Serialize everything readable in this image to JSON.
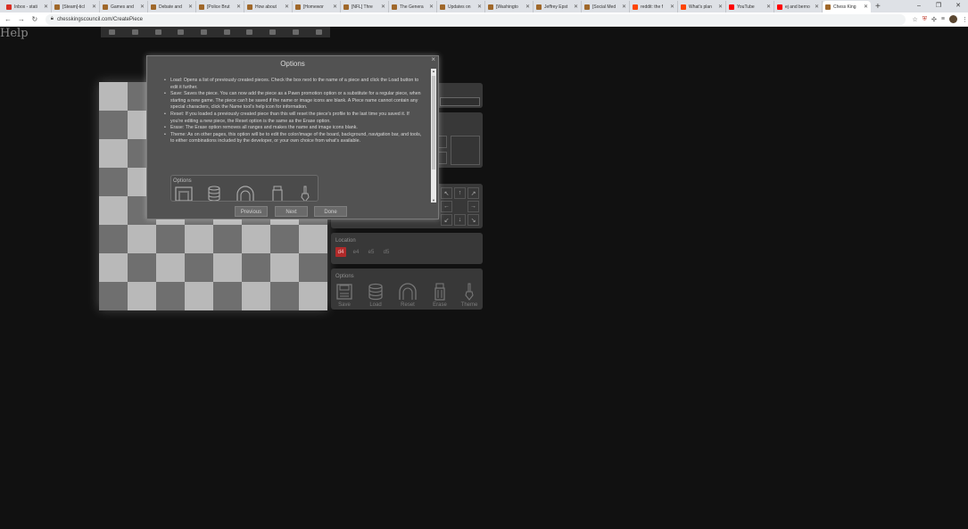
{
  "browser": {
    "tabs": [
      {
        "title": "Inbox - stati",
        "color": "#d93025"
      },
      {
        "title": "[Steam]-ticl",
        "color": "#a0682a"
      },
      {
        "title": "Games and",
        "color": "#a0682a"
      },
      {
        "title": "Debate and",
        "color": "#a0682a"
      },
      {
        "title": "[Police Brut",
        "color": "#a0682a"
      },
      {
        "title": "How about",
        "color": "#a0682a"
      },
      {
        "title": "[Homewor",
        "color": "#a0682a"
      },
      {
        "title": "[NFL] Thre",
        "color": "#a0682a"
      },
      {
        "title": "The Genera",
        "color": "#a0682a"
      },
      {
        "title": "Updates on",
        "color": "#a0682a"
      },
      {
        "title": "[Washingto",
        "color": "#a0682a"
      },
      {
        "title": "Jeffrey Epst",
        "color": "#a0682a"
      },
      {
        "title": "[Social Med",
        "color": "#a0682a"
      },
      {
        "title": "reddit: the f",
        "color": "#ff4500"
      },
      {
        "title": "What's plan",
        "color": "#ff4500"
      },
      {
        "title": "YouTube",
        "color": "#ff0000"
      },
      {
        "title": "ej and berno",
        "color": "#ff0000"
      },
      {
        "title": "Chess King",
        "color": "#a0682a",
        "active": true
      }
    ],
    "new_tab": "+",
    "url": "chesskingscouncil.com/CreatePiece"
  },
  "page": {
    "help": "Help",
    "right_panels": {
      "location_label": "Location",
      "location_squares": [
        "d4",
        "e4",
        "e5",
        "d5"
      ],
      "options_label": "Options",
      "tools": [
        {
          "label": "Save",
          "icon": "save-icon"
        },
        {
          "label": "Load",
          "icon": "load-icon"
        },
        {
          "label": "Reset",
          "icon": "reset-icon"
        },
        {
          "label": "Erase",
          "icon": "erase-icon"
        },
        {
          "label": "Theme",
          "icon": "theme-icon"
        }
      ],
      "direction_arrows": [
        "↖",
        "↑",
        "↗",
        "←",
        "",
        "→",
        "↙",
        "↓",
        "↘"
      ]
    }
  },
  "dialog": {
    "title": "Options",
    "close": "×",
    "items": [
      "Load: Opens a list of previously created pieces. Check the box next to the name of a piece and click the Load button to edit it further.",
      "Save: Saves the piece. You can now add the piece as a Pawn promotion option or a substitute for a regular piece, when starting a new game. The piece can't be saved if the name or image icons are blank. A Piece name cannot contain any special characters, click the Name tool's help icon for information.",
      "Reset: If you loaded a previously created piece than this will reset the piece's profile to the last time you saved it. If you're editing a new piece, the Reset option is the same as the Erase option.",
      "Erase: The Erase option removes all ranges and makes the name and image icons blank.",
      "Theme: As on other pages, this option will be to edit the color/image of the board, background, navigation bar, and tools, to either combinations included by the developer, or your own choice from what's available."
    ],
    "inner_options_label": "Options",
    "buttons": {
      "previous": "Previous",
      "next": "Next",
      "done": "Done"
    }
  }
}
